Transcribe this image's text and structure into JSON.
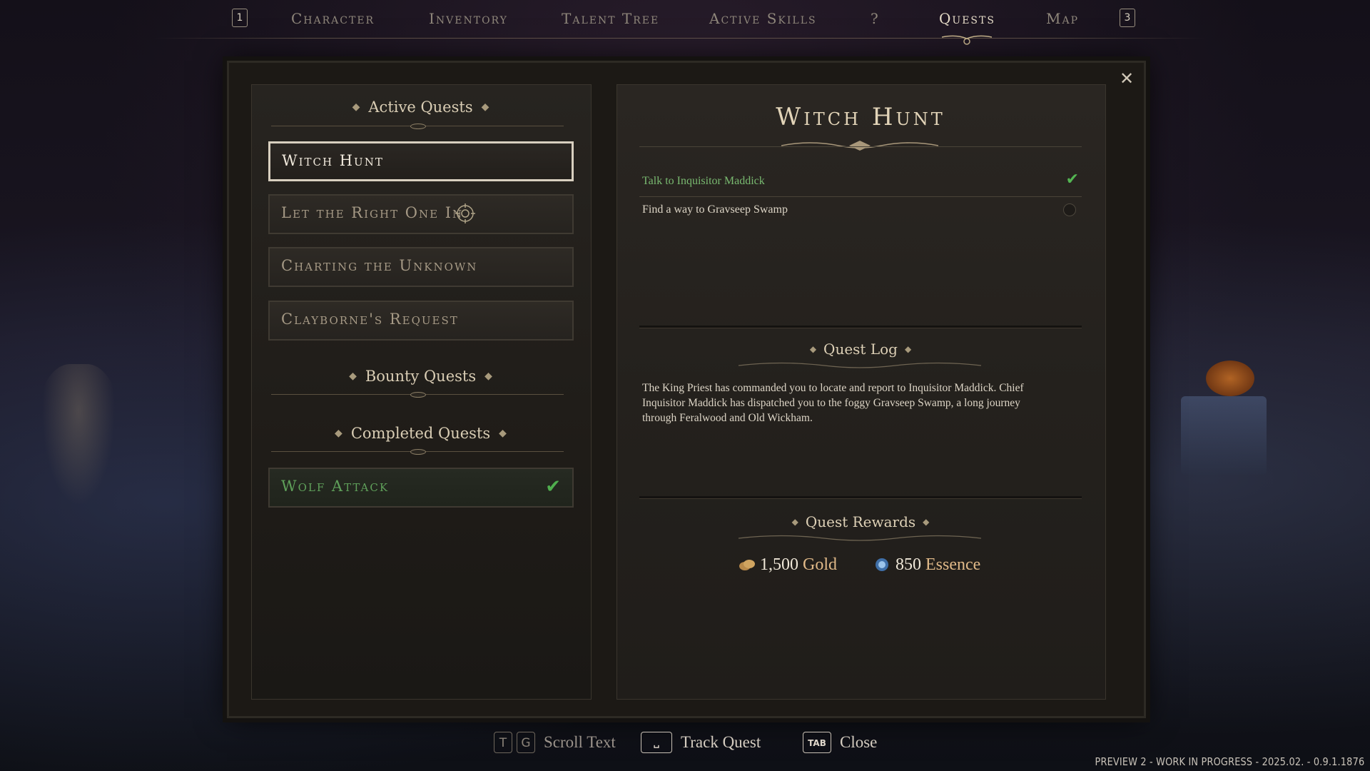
{
  "topnav": {
    "key_left": "1",
    "key_right": "3",
    "tabs": [
      {
        "label": "Character"
      },
      {
        "label": "Inventory"
      },
      {
        "label": "Talent Tree"
      },
      {
        "label": "Active Skills"
      },
      {
        "label": "?"
      },
      {
        "label": "Quests"
      },
      {
        "label": "Map"
      }
    ],
    "active_tab": "Quests"
  },
  "quest_list": {
    "active_header": "Active Quests",
    "active_quests": [
      {
        "name": "Witch Hunt",
        "selected": true
      },
      {
        "name": "Let the Right One In",
        "tracked": true
      },
      {
        "name": "Charting the Unknown"
      },
      {
        "name": "Clayborne's Request"
      }
    ],
    "bounty_header": "Bounty Quests",
    "completed_header": "Completed Quests",
    "completed_quests": [
      {
        "name": "Wolf Attack",
        "status_icon": "check-icon"
      }
    ]
  },
  "quest_detail": {
    "title": "Witch Hunt",
    "objectives": [
      {
        "text": "Talk to Inquisitor Maddick",
        "done": true
      },
      {
        "text": "Find a way to Gravseep Swamp",
        "done": false
      }
    ],
    "log_header": "Quest Log",
    "log_text": "The King Priest has commanded you to locate and report to Inquisitor Maddick. Chief Inquisitor Maddick has dispatched you to the foggy Gravseep Swamp, a long journey through Feralwood and Old Wickham.",
    "rewards_header": "Quest Rewards",
    "rewards": [
      {
        "amount": "1,500",
        "unit": "Gold",
        "icon": "gold-coin-icon"
      },
      {
        "amount": "850",
        "unit": "Essence",
        "icon": "essence-orb-icon"
      }
    ]
  },
  "hints": {
    "scroll_keys": [
      "T",
      "G"
    ],
    "scroll_label": "Scroll Text",
    "track_key": "␣",
    "track_label": "Track Quest",
    "close_key": "TAB",
    "close_label": "Close"
  },
  "version_text": "PREVIEW 2 - WORK IN PROGRESS - 2025.02. - 0.9.1.1876",
  "colors": {
    "completed_green": "#5fa05a",
    "reward_unit": "#e0b988",
    "title": "#e2d4b8"
  }
}
